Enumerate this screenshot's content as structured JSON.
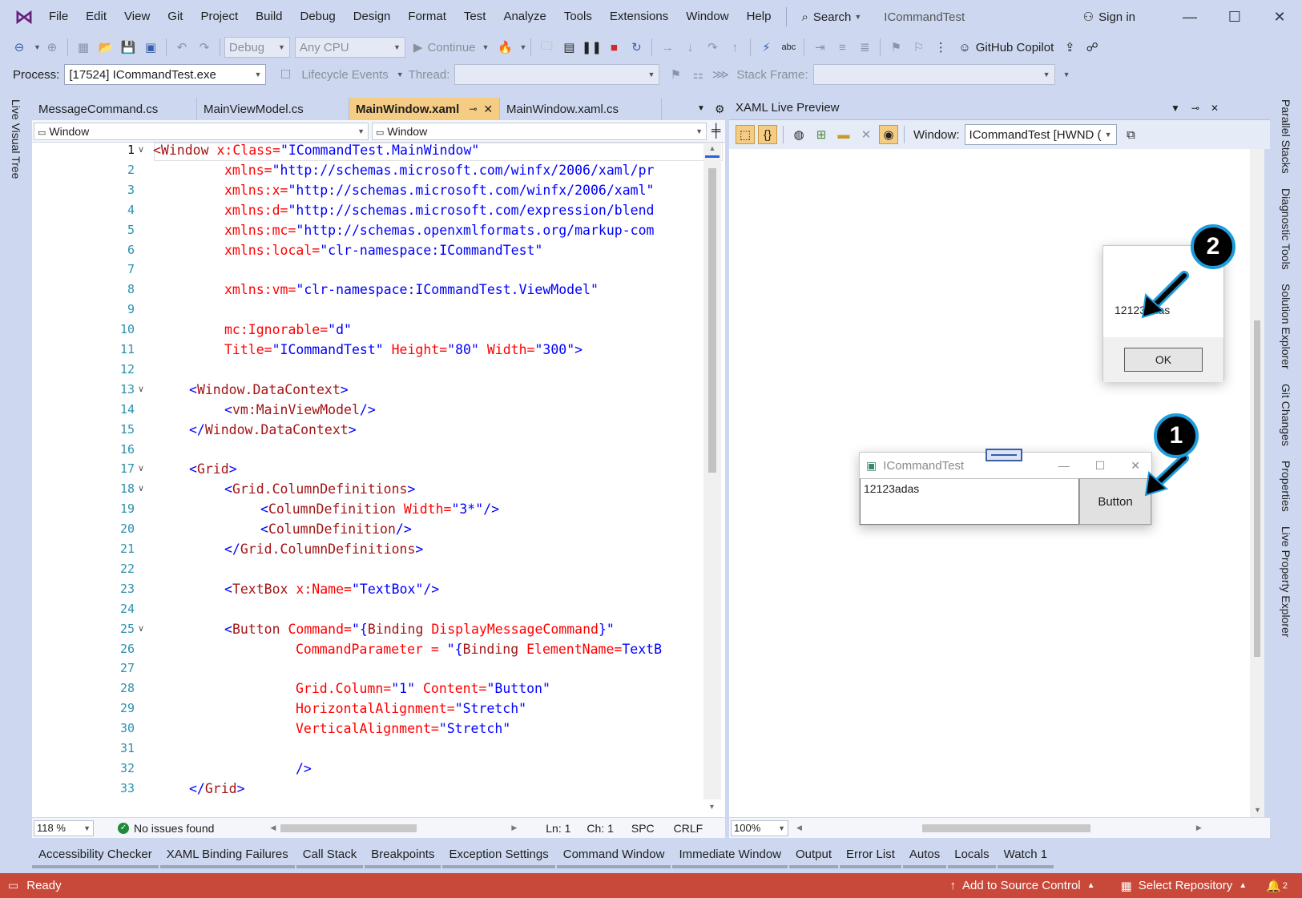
{
  "menu": {
    "items": [
      "File",
      "Edit",
      "View",
      "Git",
      "Project",
      "Build",
      "Debug",
      "Design",
      "Format",
      "Test",
      "Analyze",
      "Tools",
      "Extensions",
      "Window",
      "Help"
    ],
    "search_label": "Search",
    "solution_title": "ICommandTest",
    "sign_in": "Sign in"
  },
  "toolbar": {
    "config": "Debug",
    "platform": "Any CPU",
    "continue_label": "Continue",
    "copilot_label": "GitHub Copilot"
  },
  "debug_bar": {
    "process_label": "Process:",
    "process_value": "[17524] ICommandTest.exe",
    "lifecycle_label": "Lifecycle Events",
    "thread_label": "Thread:",
    "stack_frame_label": "Stack Frame:"
  },
  "left_vtab": "Live Visual Tree",
  "editor": {
    "tabs": [
      {
        "label": "MessageCommand.cs"
      },
      {
        "label": "MainViewModel.cs"
      },
      {
        "label": "MainWindow.xaml"
      },
      {
        "label": "MainWindow.xaml.cs"
      }
    ],
    "nav_left": "Window",
    "nav_right": "Window",
    "lines": [
      "1",
      "2",
      "3",
      "4",
      "5",
      "6",
      "7",
      "8",
      "9",
      "10",
      "11",
      "12",
      "13",
      "14",
      "15",
      "16",
      "17",
      "18",
      "19",
      "20",
      "21",
      "22",
      "23",
      "24",
      "25",
      "26",
      "27",
      "28",
      "29",
      "30",
      "31",
      "32",
      "33"
    ],
    "zoom": "118 %",
    "issues": "No issues found",
    "ln": "Ln: 1",
    "ch": "Ch: 1",
    "spc": "SPC",
    "crlf": "CRLF"
  },
  "preview": {
    "title": "XAML Live Preview",
    "window_label": "Window:",
    "window_value": "ICommandTest [HWND (",
    "zoom": "100%",
    "app_window": {
      "title": "ICommandTest",
      "textbox_value": "12123adas",
      "button_label": "Button"
    },
    "message_box": {
      "message": "12123adas",
      "ok_label": "OK"
    },
    "badge_1": "1",
    "badge_2": "2"
  },
  "right_vtabs": [
    "Parallel Stacks",
    "Diagnostic Tools",
    "Solution Explorer",
    "Git Changes",
    "Properties",
    "Live Property Explorer"
  ],
  "tool_tabs": [
    "Accessibility Checker",
    "XAML Binding Failures",
    "Call Stack",
    "Breakpoints",
    "Exception Settings",
    "Command Window",
    "Immediate Window",
    "Output",
    "Error List",
    "Autos",
    "Locals",
    "Watch 1"
  ],
  "status": {
    "ready": "Ready",
    "add_source": "Add to Source Control",
    "select_repo": "Select Repository",
    "notifications": "2"
  }
}
